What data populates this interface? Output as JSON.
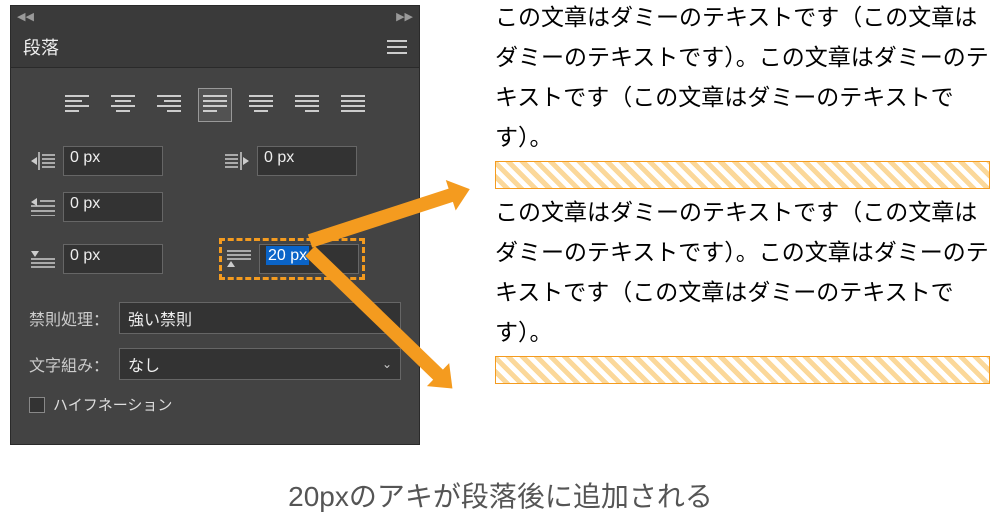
{
  "panel": {
    "title": "段落",
    "indent_left": "0 px",
    "indent_right": "0 px",
    "first_line": "0 px",
    "space_before": "0 px",
    "space_after": "20 px",
    "kinsoku_label": "禁則処理：",
    "kinsoku_value": "強い禁則",
    "mojikumi_label": "文字組み：",
    "mojikumi_value": "なし",
    "hyphenation": "ハイフネーション"
  },
  "sample": {
    "para1": "この文章はダミーのテキストです（この文章はダミーのテキストです）。この文章はダミーのテキストです（この文章はダミーのテキストです）。",
    "para2": "この文章はダミーのテキストです（この文章はダミーのテキストです）。この文章はダミーのテキストです（この文章はダミーのテキストです）。"
  },
  "caption": "20pxのアキが段落後に追加される"
}
